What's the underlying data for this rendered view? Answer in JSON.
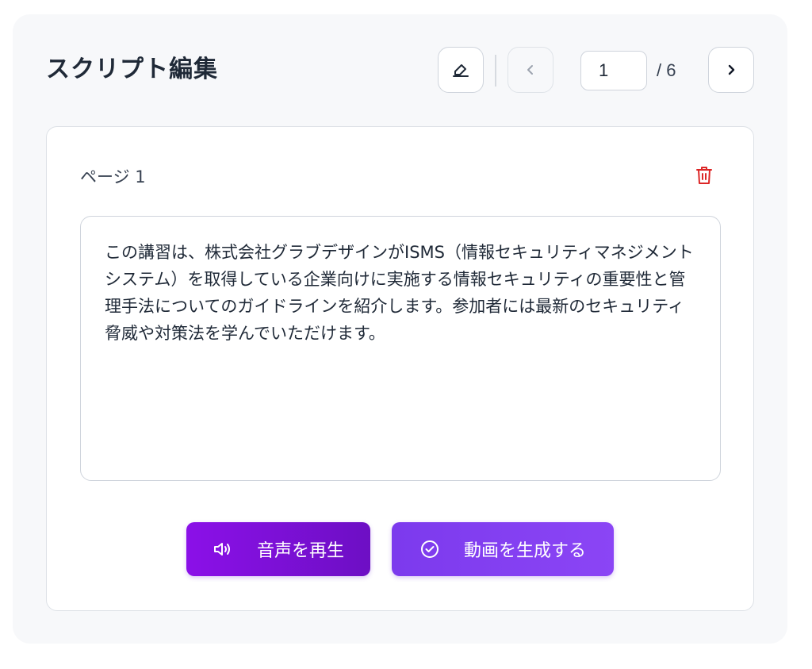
{
  "header": {
    "title": "スクリプト編集"
  },
  "pagination": {
    "current_page": "1",
    "total_label": "/ 6"
  },
  "toolbar_icons": {
    "edit": "pen-icon",
    "prev": "chevron-left-icon",
    "next": "chevron-right-icon"
  },
  "page": {
    "label": "ページ 1",
    "delete_icon": "trash-icon",
    "script_text": "この講習は、株式会社グラブデザインがISMS（情報セキュリティマネジメントシステム）を取得している企業向けに実施する情報セキュリティの重要性と管理手法についてのガイドラインを紹介します。参加者には最新のセキュリティ脅威や対策法を学んでいただけます。"
  },
  "actions": {
    "play_label": "音声を再生",
    "play_icon": "speaker-icon",
    "generate_label": "動画を生成する",
    "generate_icon": "check-circle-icon"
  },
  "colors": {
    "accent": "#7c3aed",
    "danger": "#dc2626"
  }
}
